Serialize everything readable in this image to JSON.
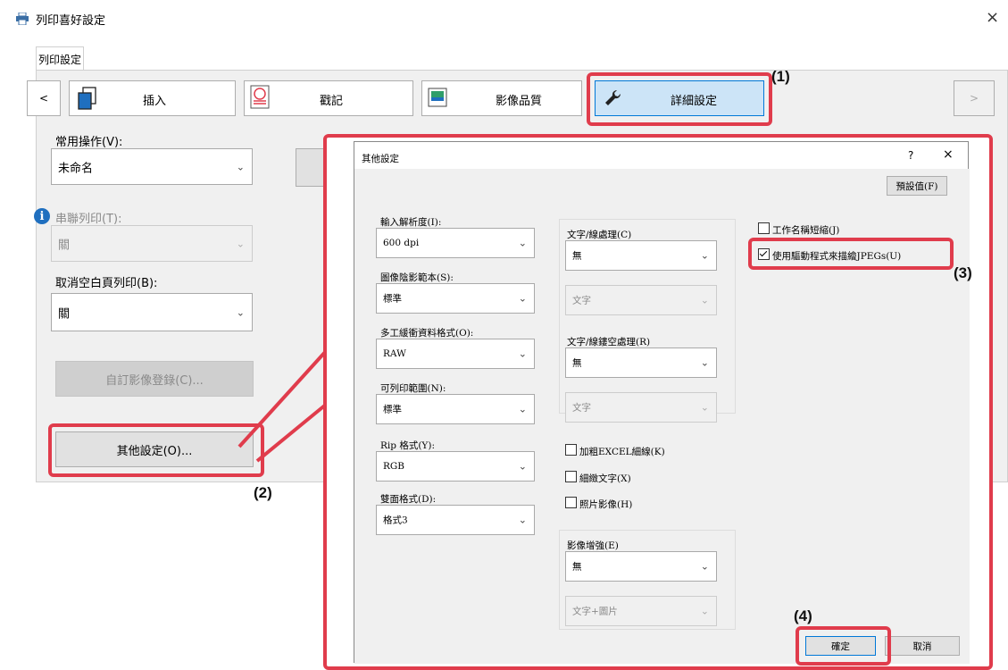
{
  "window": {
    "title": "列印喜好設定",
    "close": "×"
  },
  "tab_page": "列印設定",
  "nav": {
    "prev": "<",
    "next": ">"
  },
  "tabs": [
    {
      "label": "插入",
      "icon": "insert-pages-icon"
    },
    {
      "label": "戳記",
      "icon": "stamp-icon"
    },
    {
      "label": "影像品質",
      "icon": "image-quality-icon"
    },
    {
      "label": "詳細設定",
      "icon": "wrench-icon"
    }
  ],
  "left": {
    "common_label": "常用操作(V):",
    "common_value": "未命名",
    "tandem_label": "串聯列印(T):",
    "tandem_value": "關",
    "blank_label": "取消空白頁列印(B):",
    "blank_value": "關",
    "custom_image_button": "自訂影像登錄(C)...",
    "other_settings_button": "其他設定(O)..."
  },
  "dialog": {
    "title": "其他設定",
    "help": "?",
    "close": "×",
    "defaults_button": "預設值(F)",
    "col1": [
      {
        "label": "輸入解析度(I):",
        "value": "600 dpi"
      },
      {
        "label": "圖像陰影範本(S):",
        "value": "標準"
      },
      {
        "label": "多工緩衝資料格式(O):",
        "value": "RAW"
      },
      {
        "label": "可列印範圍(N):",
        "value": "標準"
      },
      {
        "label": "Rip 格式(Y):",
        "value": "RGB"
      },
      {
        "label": "雙面格式(D):",
        "value": "格式3"
      }
    ],
    "text_line": {
      "label": "文字/線處理(C)",
      "value": "無",
      "sub_value": "文字"
    },
    "text_hollow": {
      "label": "文字/線鏤空處理(R)",
      "value": "無",
      "sub_value": "文字"
    },
    "checks_mid": [
      {
        "label": "加粗EXCEL細線(K)",
        "checked": false
      },
      {
        "label": "細緻文字(X)",
        "checked": false
      },
      {
        "label": "照片影像(H)",
        "checked": false
      }
    ],
    "image_enhance": {
      "label": "影像增強(E)",
      "value": "無",
      "sub_value": "文字+圖片"
    },
    "checks_right": [
      {
        "label": "工作名稱短縮(J)",
        "checked": false
      },
      {
        "label": "使用驅動程式來描繪JPEGs(U)",
        "checked": true
      }
    ],
    "ok": "確定",
    "cancel": "取消"
  },
  "callouts": [
    "(1)",
    "(2)",
    "(3)",
    "(4)"
  ],
  "colors": {
    "highlight": "#e03c4c",
    "selected_tab": "#cce4f7"
  }
}
